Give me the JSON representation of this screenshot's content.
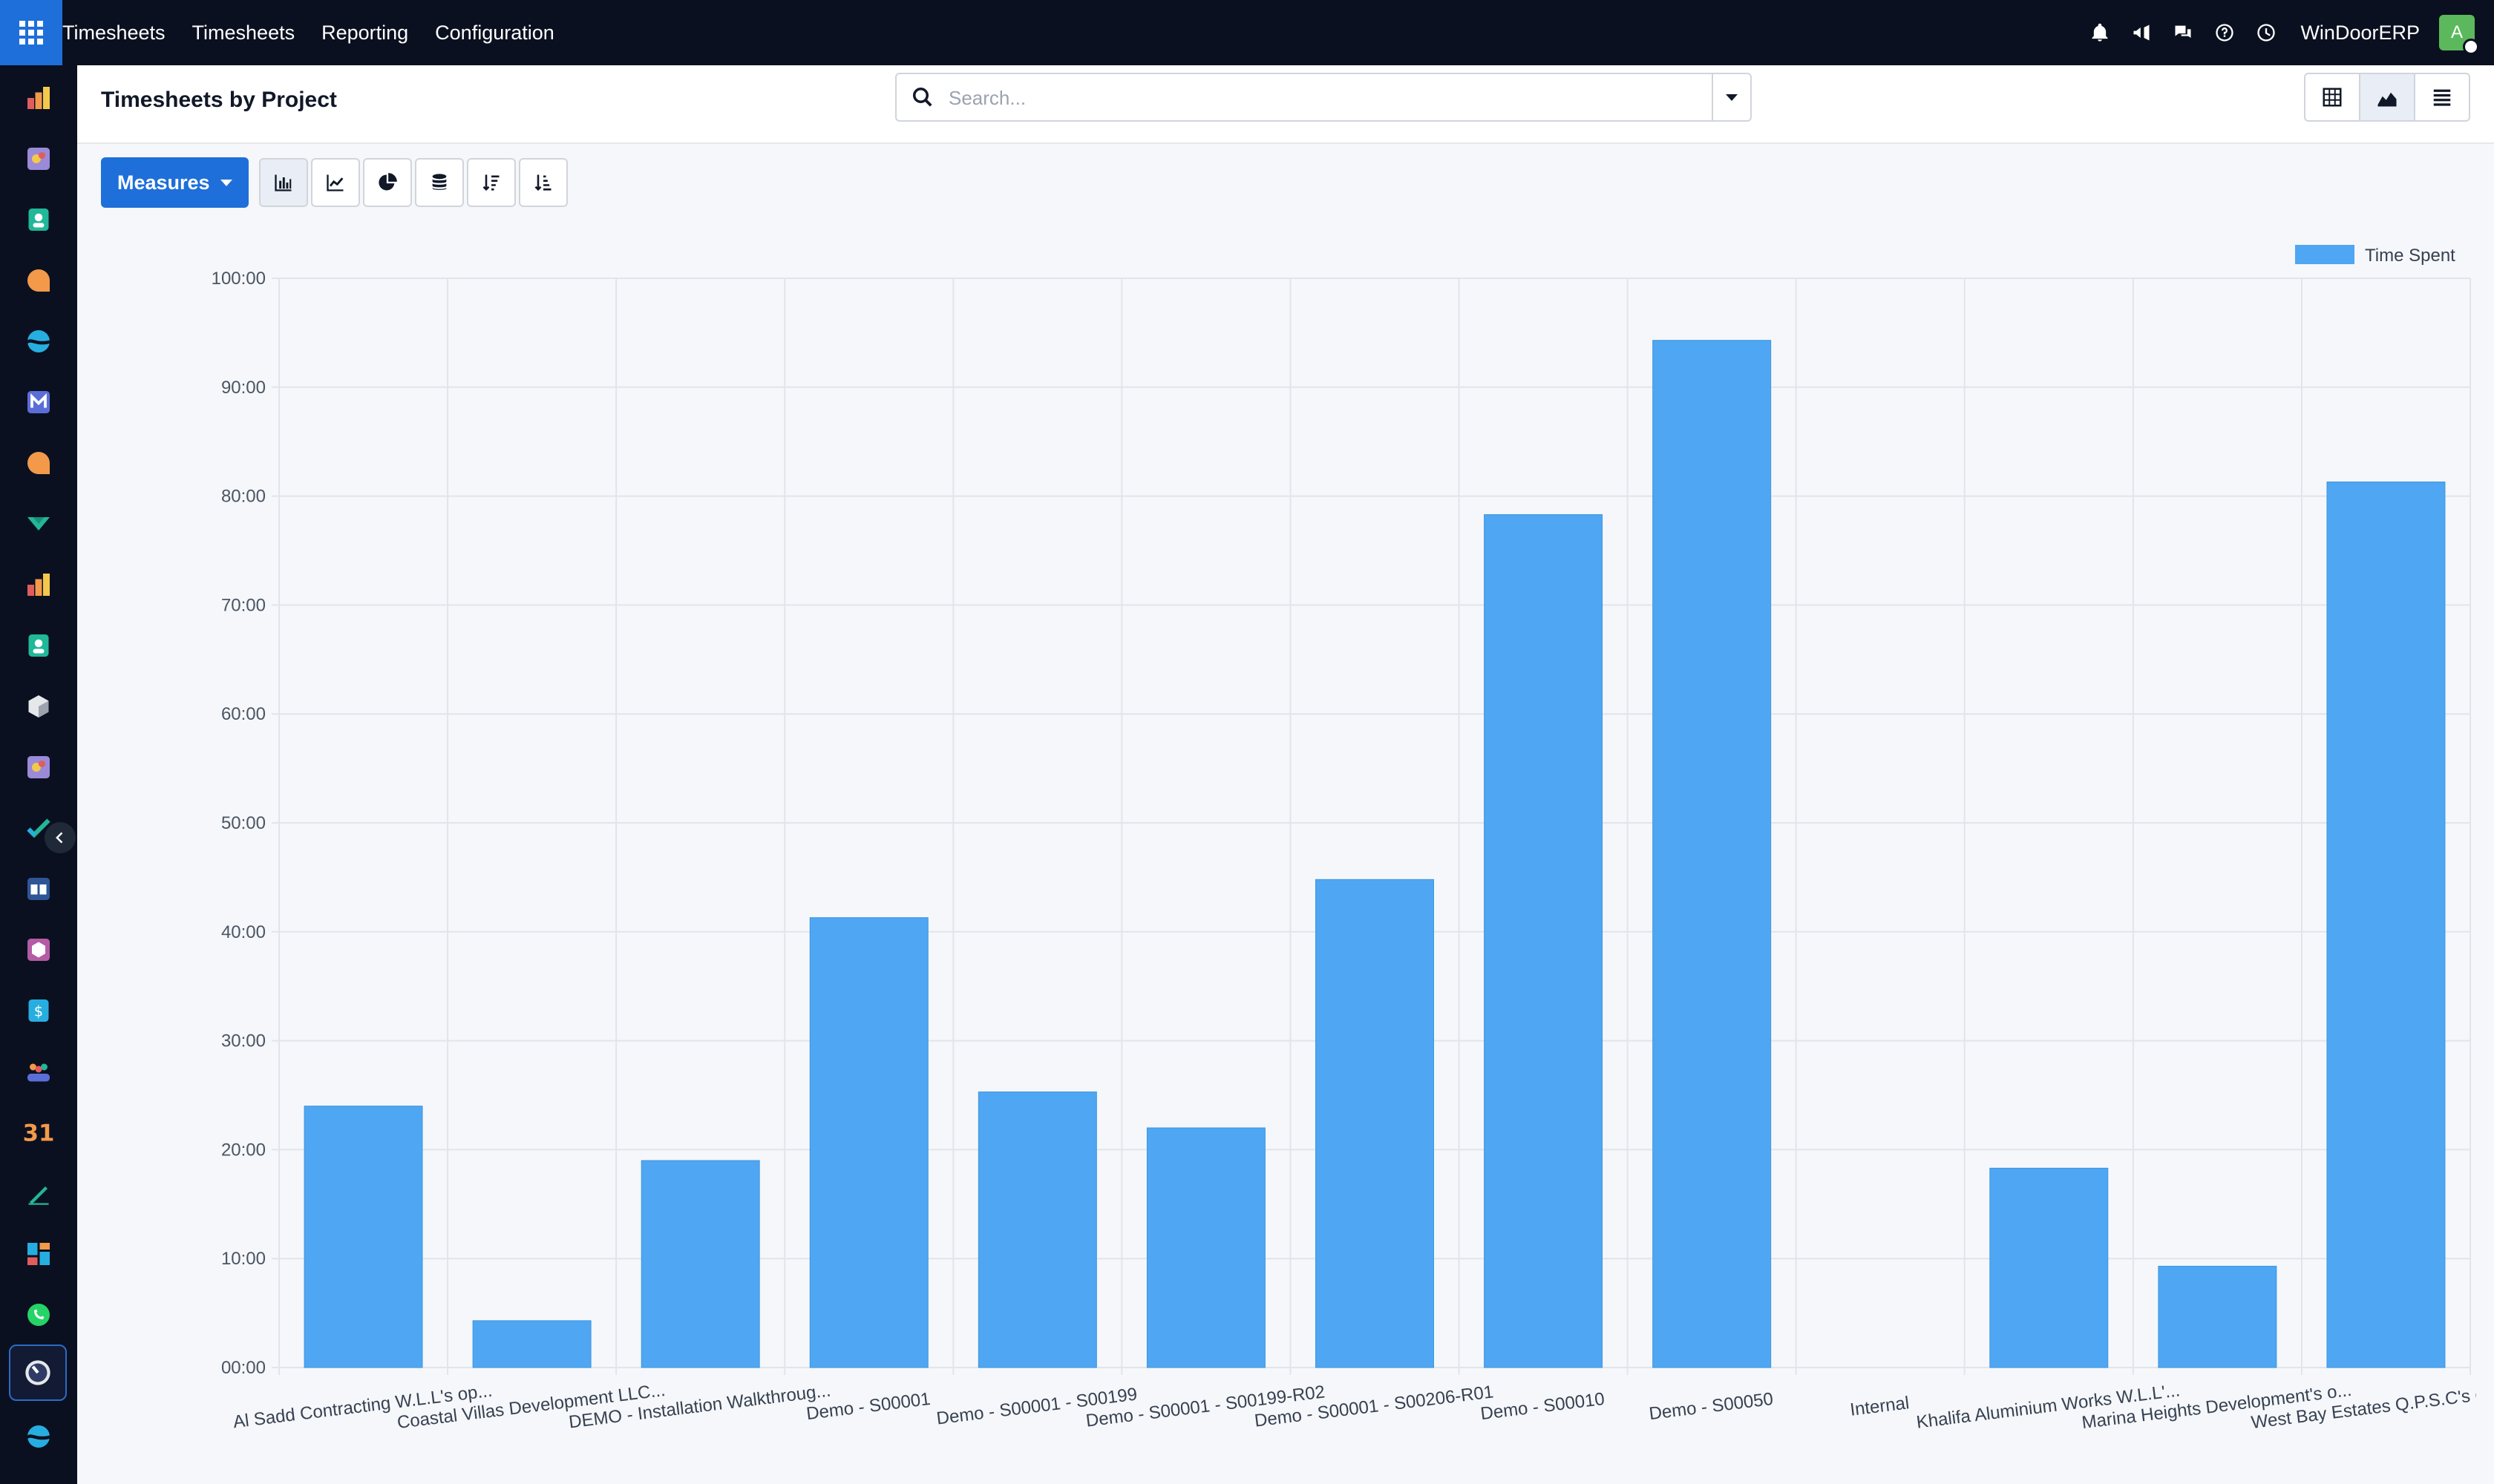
{
  "nav": {
    "menu": [
      "Timesheets",
      "Timesheets",
      "Reporting",
      "Configuration"
    ],
    "company": "WinDoorERP",
    "avatar_letter": "A"
  },
  "control": {
    "title": "Timesheets by Project",
    "search_placeholder": "Search..."
  },
  "toolbar": {
    "measures_label": "Measures"
  },
  "sidebar": {
    "apps": [
      "dashboard-app-icon",
      "documents-app-icon",
      "contacts-app-icon",
      "discuss-app-icon",
      "sales-app-icon",
      "email-marketing-app-icon",
      "helpdesk-app-icon",
      "project-app-icon",
      "reporting-app-icon",
      "employees-app-icon",
      "inventory-app-icon",
      "field-service-app-icon",
      "planning-app-icon",
      "knowledge-app-icon",
      "products-app-icon",
      "invoicing-app-icon",
      "team-app-icon",
      "calendar-app-icon",
      "sign-app-icon",
      "dashboards-app-icon",
      "whatsapp-app-icon",
      "timesheets-app-icon",
      "website-app-icon"
    ],
    "calendar_day": "31"
  },
  "chart_data": {
    "type": "bar",
    "title": "",
    "xlabel": "",
    "ylabel": "",
    "ylim": [
      0,
      100
    ],
    "yticks": [
      "00:00",
      "10:00",
      "20:00",
      "30:00",
      "40:00",
      "50:00",
      "60:00",
      "70:00",
      "80:00",
      "90:00",
      "100:00"
    ],
    "grid": true,
    "legend": "top-right",
    "categories": [
      "Al Sadd Contracting W.L.L's op...",
      "Coastal Villas Development LLC...",
      "DEMO - Installation Walkthroug...",
      "Demo - S00001",
      "Demo - S00001 - S00199",
      "Demo - S00001 - S00199-R02",
      "Demo - S00001 - S00206-R01",
      "Demo - S00010",
      "Demo - S00050",
      "Internal",
      "Khalifa Aluminium Works W.L.L'...",
      "Marina Heights Development's o...",
      "West Bay Estates Q.P.S.C's opp..."
    ],
    "series": [
      {
        "name": "Time Spent",
        "color": "#4fa6f2",
        "values": [
          24,
          4.3,
          19,
          41.3,
          25.3,
          22,
          44.8,
          78.3,
          94.3,
          0,
          18.3,
          9.3,
          81.3
        ]
      }
    ]
  }
}
